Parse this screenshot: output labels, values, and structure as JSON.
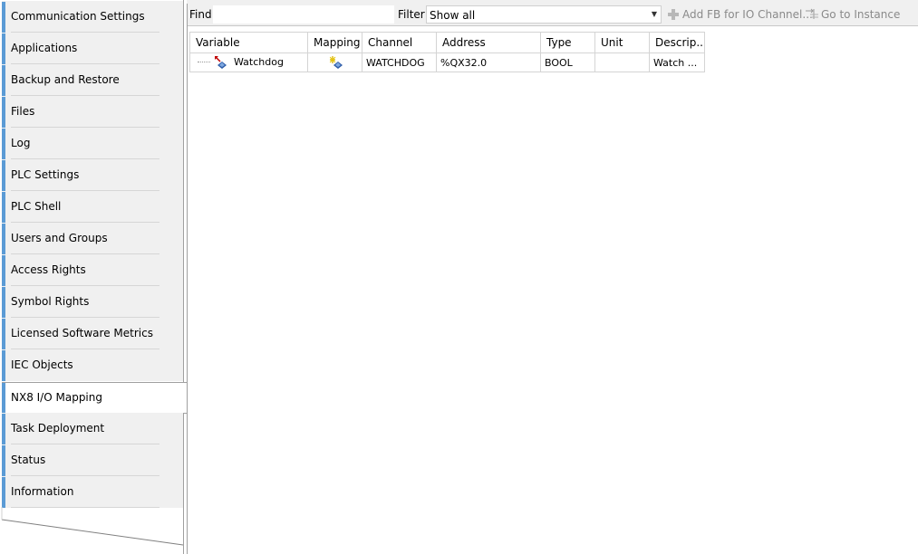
{
  "sidebar": {
    "tabs": [
      {
        "label": "Communication Settings"
      },
      {
        "label": "Applications"
      },
      {
        "label": "Backup and Restore"
      },
      {
        "label": "Files"
      },
      {
        "label": "Log"
      },
      {
        "label": "PLC Settings"
      },
      {
        "label": "PLC Shell"
      },
      {
        "label": "Users and Groups"
      },
      {
        "label": "Access Rights"
      },
      {
        "label": "Symbol Rights"
      },
      {
        "label": "Licensed Software Metrics"
      },
      {
        "label": "IEC Objects"
      },
      {
        "label": "NX8 I/O Mapping",
        "active": true
      },
      {
        "label": "Task Deployment"
      },
      {
        "label": "Status"
      },
      {
        "label": "Information"
      }
    ]
  },
  "toolbar": {
    "find_label": "Find",
    "find_value": "",
    "filter_label": "Filter",
    "filter_value": "Show all",
    "add_fb_label": "Add FB for IO Channel...",
    "goto_label": "Go to Instance"
  },
  "table": {
    "columns": [
      "Variable",
      "Mapping",
      "Channel",
      "Address",
      "Type",
      "Unit",
      "Descrip..."
    ],
    "rows": [
      {
        "variable": "Watchdog",
        "mapping_icon": "map-to-new-variable-icon",
        "channel": "WATCHDOG",
        "address": "%QX32.0",
        "type": "BOOL",
        "unit": "",
        "description": "Watch ..."
      }
    ]
  },
  "colors": {
    "tab_accent": "#5b9bd5",
    "disabled_text": "#8a8a8a"
  }
}
